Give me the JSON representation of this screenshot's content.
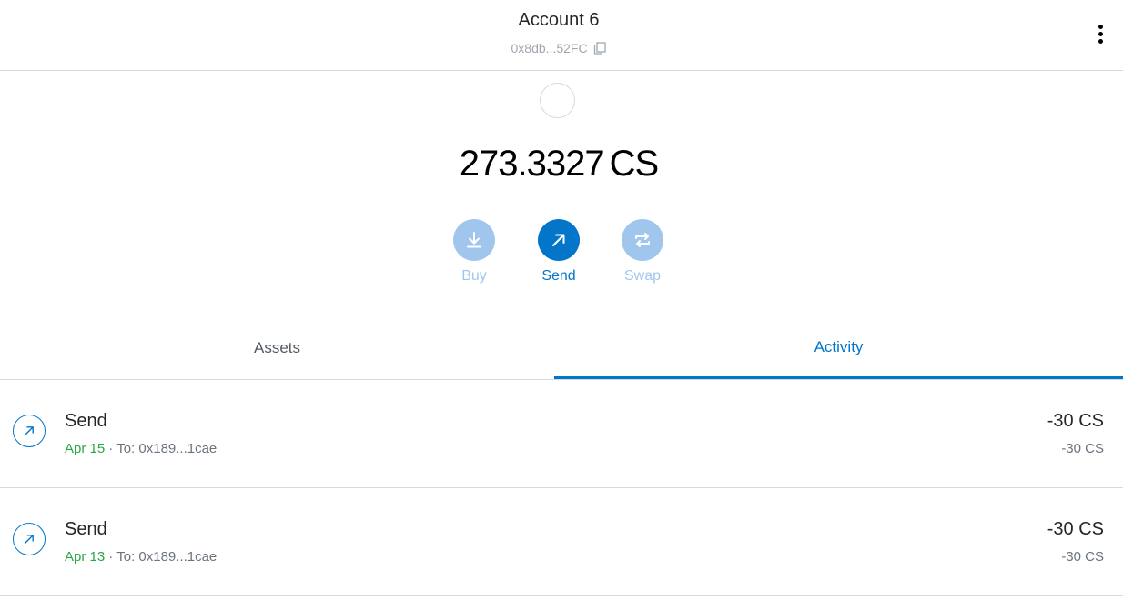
{
  "header": {
    "account_name": "Account 6",
    "address": "0x8db...52FC",
    "menu_icon": "kebab-menu-icon",
    "copy_icon": "copy-icon"
  },
  "wallet": {
    "balance_value": "273.3327",
    "balance_unit": "CS"
  },
  "actions": [
    {
      "label": "Buy",
      "icon": "download-icon",
      "state": "disabled"
    },
    {
      "label": "Send",
      "icon": "arrow-up-right-icon",
      "state": "active"
    },
    {
      "label": "Swap",
      "icon": "swap-arrows-icon",
      "state": "disabled"
    }
  ],
  "tabs": [
    {
      "label": "Assets",
      "active": false
    },
    {
      "label": "Activity",
      "active": true
    }
  ],
  "transactions": [
    {
      "title": "Send",
      "date": "Apr 15",
      "separator": "·",
      "recipient": "To: 0x189...1cae",
      "amount": "-30 CS",
      "amount_secondary": "-30 CS"
    },
    {
      "title": "Send",
      "date": "Apr 13",
      "separator": "·",
      "recipient": "To: 0x189...1cae",
      "amount": "-30 CS",
      "amount_secondary": "-30 CS"
    }
  ],
  "colors": {
    "accent": "#0376c9",
    "accent_disabled": "#a1c6ee",
    "date_green": "#28a745",
    "border": "#d6d9dc"
  }
}
